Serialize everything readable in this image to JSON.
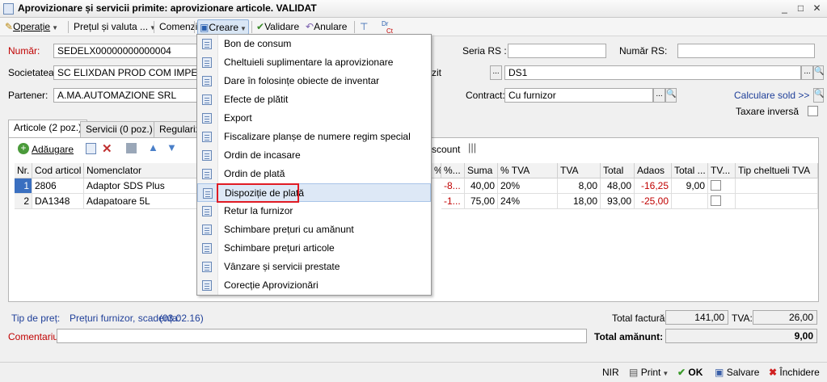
{
  "window": {
    "title": "Aprovizionare și servicii primite: aprovizionare articole. VALIDAT",
    "min": "_",
    "max": "□",
    "close": "✕"
  },
  "toolbar": {
    "operatie": "Operație",
    "pretul": "Prețul și valuta ...",
    "comenzi": "Comenzi",
    "creare": "Creare",
    "validare": "Validare",
    "anulare": "Anulare",
    "dr": "Dr",
    "ct": "Ct"
  },
  "form": {
    "numar_label": "Număr:",
    "numar_value": "SEDELX00000000000004",
    "seria_label": "Seria RS :",
    "seria_value": "",
    "numar_rs_label": "Număr RS:",
    "numar_rs_value": "",
    "societatea_label": "Societatea:",
    "societatea_value": "SC ELIXDAN PROD COM IMPEX SR",
    "depozit_partial": "zit",
    "depozit_value": "DS1",
    "partener_label": "Partener:",
    "partener_value": "A.MA.AUTOMAZIONE SRL",
    "contract_label": "Contract:",
    "contract_value": "Cu furnizor",
    "calculare_sold": "Calculare sold >>",
    "taxare_inversa": "Taxare inversă",
    "dots": "...",
    "search": "🔍"
  },
  "tabs": [
    {
      "label": "Articole (2 poz.)"
    },
    {
      "label": "Servicii (0 poz.)"
    },
    {
      "label": "Regulariza"
    }
  ],
  "gridtoolbar": {
    "adaugare": "Adăugare",
    "discount": "scount"
  },
  "grid": {
    "headers": [
      "Nr.",
      "Cod articol",
      "Nomenclator",
      "%...",
      "%...",
      "Suma",
      "% TVA",
      "TVA",
      "Total",
      "Adaos",
      "Total ...",
      "TV...",
      "Tip cheltueli TVA"
    ],
    "rows": [
      {
        "nr": "1",
        "cod": "2806",
        "nomenclator": "Adaptor SDS Plus",
        "p1": "-8...",
        "p2": "",
        "suma": "40,00",
        "pct_tva": "20%",
        "tva": "8,00",
        "total": "48,00",
        "adaos": "-16,25",
        "total2": "9,00"
      },
      {
        "nr": "2",
        "cod": "DA1348",
        "nomenclator": "Adapatoare 5L",
        "p1": "-1...",
        "p2": "",
        "suma": "75,00",
        "pct_tva": "24%",
        "tva": "18,00",
        "total": "93,00",
        "adaos": "-25,00",
        "total2": ""
      }
    ]
  },
  "menu": {
    "items": [
      {
        "label": "Bon de consum"
      },
      {
        "label": "Cheltuieli suplimentare la aprovizionare"
      },
      {
        "label": "Dare în folosințe obiecte de inventar"
      },
      {
        "label": "Efecte de plătit"
      },
      {
        "label": "Export"
      },
      {
        "label": "Fiscalizare planșe de numere regim special"
      },
      {
        "label": "Ordin de incasare"
      },
      {
        "label": "Ordin de plată"
      },
      {
        "label": "Dispoziție de plată"
      },
      {
        "label": "Retur la furnizor"
      },
      {
        "label": "Schimbare prețuri cu amănunt"
      },
      {
        "label": "Schimbare prețuri articole"
      },
      {
        "label": "Vânzare și servicii prestate"
      },
      {
        "label": "Corecție Aprovizionări"
      }
    ]
  },
  "footer": {
    "tip_pret_label": "Tip de preț:",
    "tip_pret_value": "Prețuri furnizor, scadența:",
    "scadenta": "(03.02.16)",
    "total_factura_label": "Total factură:",
    "total_factura_value": "141,00",
    "tva_label": "TVA:",
    "tva_value": "26,00",
    "comentariu_label": "Comentariu:",
    "total_amanunt_label": "Total amănunt:",
    "total_amanunt_value": "9,00"
  },
  "statusbar": {
    "nir": "NIR",
    "print": "Print",
    "ok": "OK",
    "salvare": "Salvare",
    "inchidere": "Închidere"
  }
}
